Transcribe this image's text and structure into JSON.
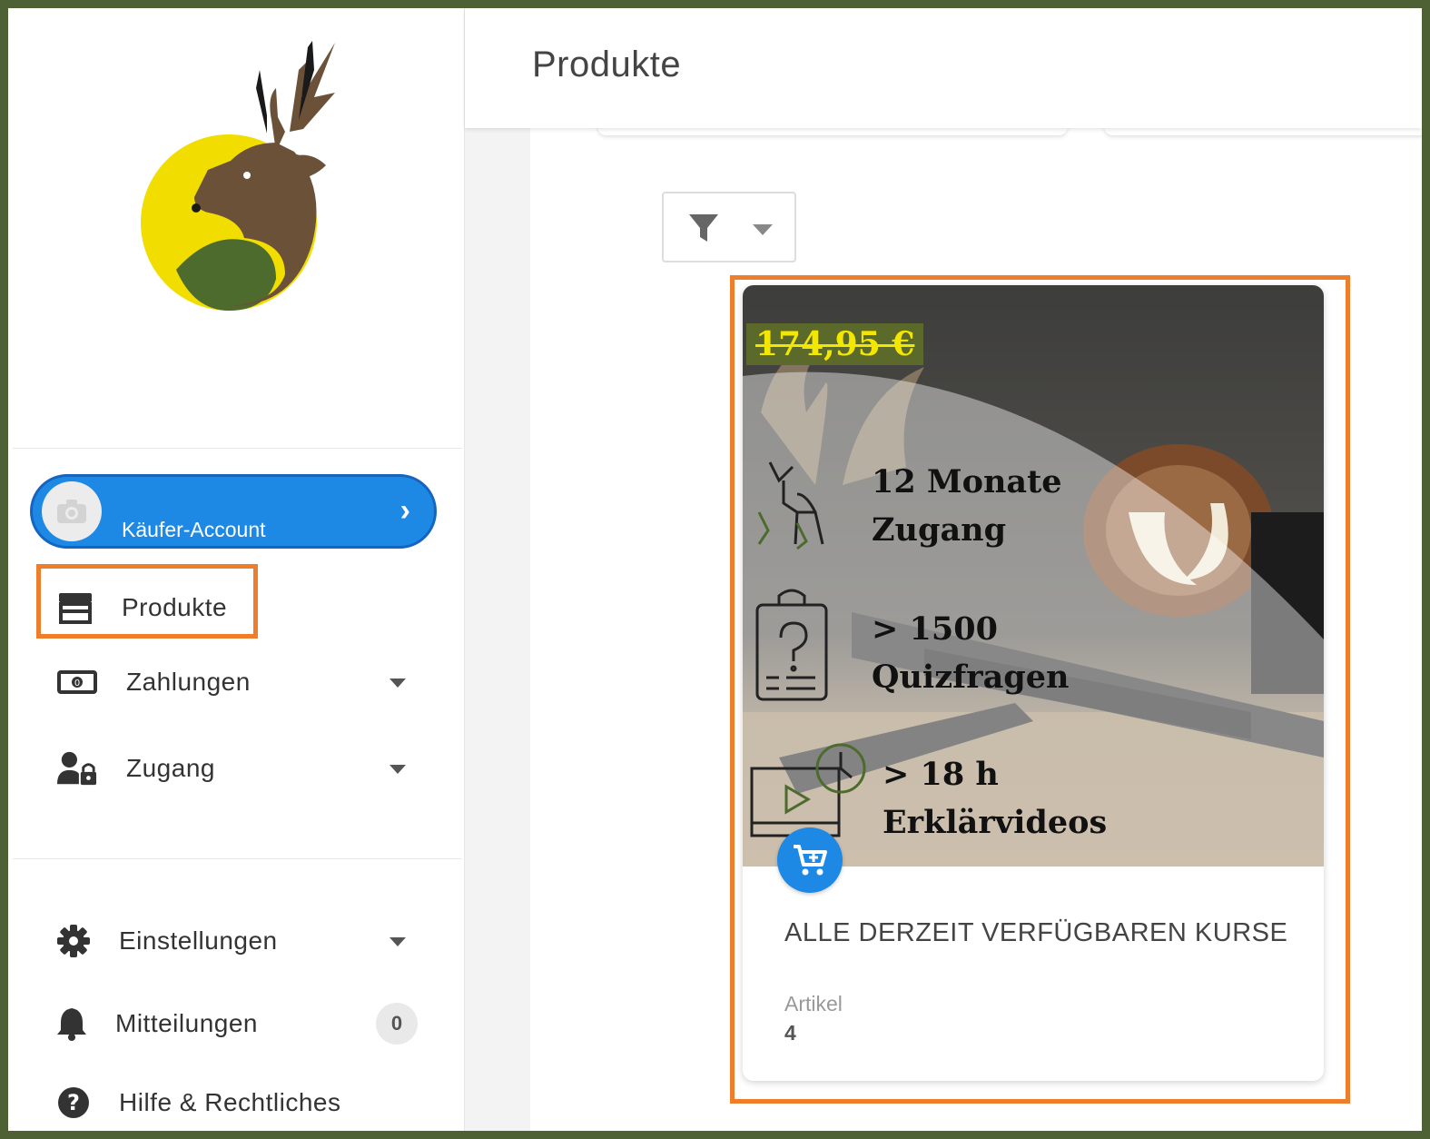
{
  "header": {
    "title": "Produkte"
  },
  "sidebar": {
    "account": {
      "label": "Käufer-Account"
    },
    "items": [
      {
        "label": "Produkte"
      },
      {
        "label": "Zahlungen"
      },
      {
        "label": "Zugang"
      },
      {
        "label": "Einstellungen"
      },
      {
        "label": "Mitteilungen",
        "badge": "0"
      },
      {
        "label": "Hilfe & Rechtliches"
      }
    ]
  },
  "product": {
    "price": "174,95 €",
    "features": [
      "12 Monate",
      "Zugang",
      "> 1500",
      "Quizfragen",
      "> 18 h",
      "Erklärvideos"
    ],
    "title": "ALLE DERZEIT VERFÜGBAREN KURSE",
    "subtitle": "Artikel",
    "count": "4"
  },
  "colors": {
    "accent": "#1e88e5",
    "highlight": "#ee7d2c",
    "frame": "#4d6135"
  }
}
